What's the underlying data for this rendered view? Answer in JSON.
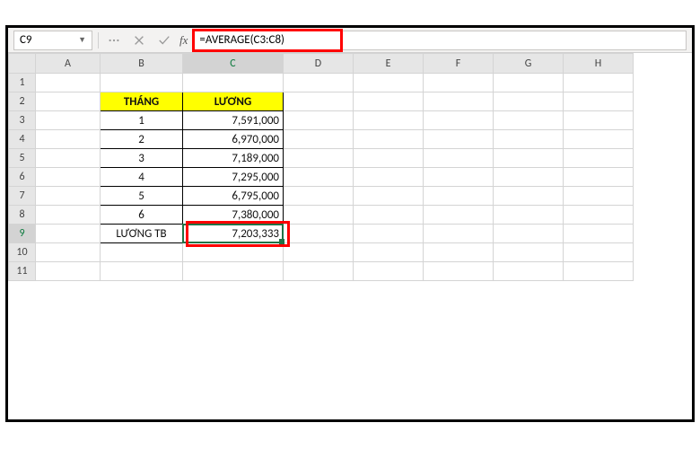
{
  "name_box": "C9",
  "formula": "=AVERAGE(C3:C8)",
  "columns": [
    "A",
    "B",
    "C",
    "D",
    "E",
    "F",
    "G",
    "H"
  ],
  "row_numbers": [
    "1",
    "2",
    "3",
    "4",
    "5",
    "6",
    "7",
    "8",
    "9",
    "10",
    "11"
  ],
  "headers": {
    "thang": "THÁNG",
    "luong": "LƯƠNG"
  },
  "rows": [
    {
      "thang": "1",
      "luong": "7,591,000"
    },
    {
      "thang": "2",
      "luong": "6,970,000"
    },
    {
      "thang": "3",
      "luong": "7,189,000"
    },
    {
      "thang": "4",
      "luong": "7,295,000"
    },
    {
      "thang": "5",
      "luong": "6,795,000"
    },
    {
      "thang": "6",
      "luong": "7,380,000"
    }
  ],
  "avg_label": "LƯƠNG TB",
  "avg_value": "7,203,333",
  "selected_col": "C",
  "selected_row": "9"
}
